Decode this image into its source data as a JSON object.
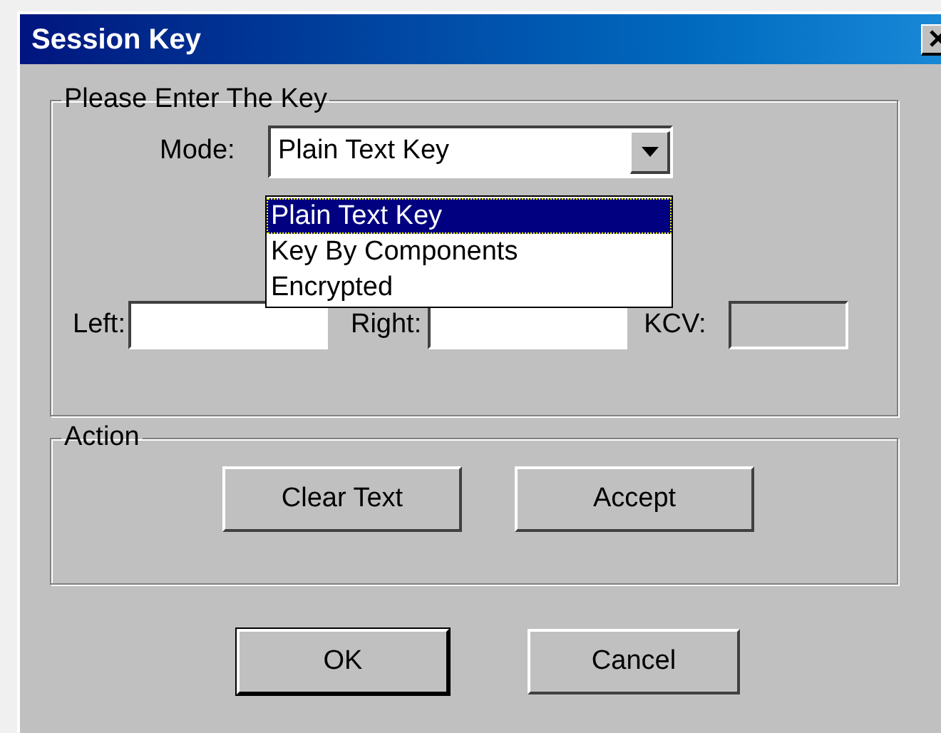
{
  "window": {
    "title": "Session Key"
  },
  "key_group": {
    "title": "Please Enter The Key",
    "mode": {
      "label": "Mode:",
      "value": "Plain Text Key",
      "expanded": true,
      "options": [
        {
          "label": "Plain Text Key",
          "selected": true
        },
        {
          "label": "Key By Components",
          "selected": false
        },
        {
          "label": "Encrypted",
          "selected": false
        }
      ]
    },
    "fields": [
      {
        "label": "Left:",
        "disabled": false
      },
      {
        "label": "Right:",
        "disabled": false
      },
      {
        "label": "KCV:",
        "disabled": true
      }
    ]
  },
  "action_group": {
    "title": "Action",
    "buttons": [
      "Clear Text",
      "Accept"
    ]
  },
  "buttons": [
    {
      "label": "OK",
      "default": true
    },
    {
      "label": "Cancel",
      "default": false
    }
  ]
}
